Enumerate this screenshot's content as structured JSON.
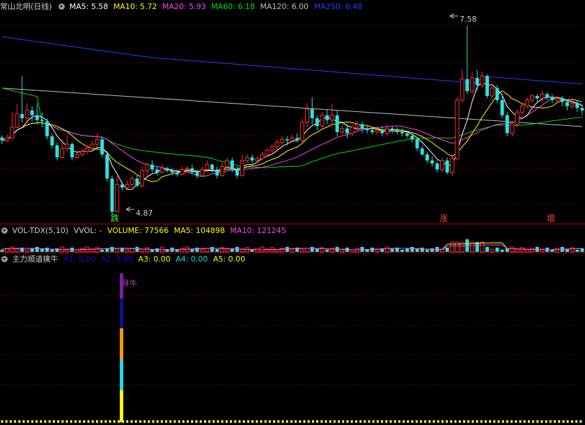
{
  "main_panel": {
    "stock_name": "常山北明",
    "period": "(日线)",
    "ma": [
      {
        "label": "MA5: ",
        "value": "5.58",
        "color": "#ffffff"
      },
      {
        "label": "MA10: ",
        "value": "5.72",
        "color": "#ffff00"
      },
      {
        "label": "MA20: ",
        "value": "5.93",
        "color": "#ff40ff"
      },
      {
        "label": "MA60: ",
        "value": "6.18",
        "color": "#00e000"
      },
      {
        "label": "MA120: ",
        "value": "6.00",
        "color": "#c0c0c0"
      },
      {
        "label": "MA250: ",
        "value": "6.48",
        "color": "#2040ff"
      }
    ],
    "high_marker": "7.58",
    "low_marker": "4.87",
    "signals": [
      {
        "text": "跌",
        "color": "#40ff40"
      },
      {
        "text": "涨",
        "color": "#ff4040"
      },
      {
        "text": "增",
        "color": "#ff4040"
      }
    ]
  },
  "volume_panel": {
    "indicator": "VOL-TDX(5,10)",
    "vvol": "VVOL: -",
    "volume_label": "VOLUME: ",
    "volume_value": "77566",
    "ma5_label": "MA5: ",
    "ma5_value": "104898",
    "ma10_label": "MA10: ",
    "ma10_value": "121245"
  },
  "indicator_panel": {
    "name": "主力顺道擒牛",
    "items": [
      {
        "label": "A1: ",
        "value": "0.00",
        "color": "#1010c0"
      },
      {
        "label": "A2: ",
        "value": "0.00",
        "color": "#1010c0"
      },
      {
        "label": "A3: ",
        "value": "0.00",
        "color": "#ffff00"
      },
      {
        "label": "A4: ",
        "value": "0.00",
        "color": "#00e0e0"
      },
      {
        "label": "A5: ",
        "value": "0.00",
        "color": "#ffff00"
      }
    ],
    "signal_label": "寻牛"
  },
  "colors": {
    "up": "#ff3030",
    "down": "#30e0e0",
    "grid": "#6a0000",
    "panel_border": "#c00000"
  },
  "ohlc": [
    [
      5.73,
      5.68,
      5.62,
      5.76
    ],
    [
      5.68,
      5.72,
      5.65,
      5.78
    ],
    [
      5.72,
      5.9,
      5.7,
      6.15
    ],
    [
      5.9,
      6.12,
      5.88,
      6.28
    ],
    [
      6.12,
      6.05,
      5.98,
      6.75
    ],
    [
      6.05,
      6.18,
      6.0,
      6.3
    ],
    [
      6.18,
      6.1,
      6.0,
      6.25
    ],
    [
      6.1,
      6.02,
      5.95,
      6.3
    ],
    [
      6.02,
      6.0,
      5.9,
      6.15
    ],
    [
      6.0,
      5.75,
      5.7,
      6.05
    ],
    [
      5.75,
      5.6,
      5.55,
      5.8
    ],
    [
      5.6,
      5.4,
      5.35,
      5.65
    ],
    [
      5.4,
      5.55,
      5.38,
      5.7
    ],
    [
      5.55,
      5.62,
      5.5,
      5.75
    ],
    [
      5.62,
      5.4,
      5.35,
      5.65
    ],
    [
      5.4,
      5.45,
      5.38,
      5.52
    ],
    [
      5.45,
      5.5,
      5.42,
      5.55
    ],
    [
      5.5,
      5.55,
      5.45,
      5.6
    ],
    [
      5.55,
      5.62,
      5.5,
      5.68
    ],
    [
      5.62,
      5.7,
      5.58,
      5.8
    ],
    [
      5.7,
      5.45,
      5.4,
      5.75
    ],
    [
      5.45,
      5.05,
      5.0,
      5.5
    ],
    [
      5.05,
      4.5,
      4.45,
      5.1
    ],
    [
      4.5,
      4.95,
      4.87,
      5.1
    ],
    [
      4.95,
      4.9,
      4.85,
      5.0
    ],
    [
      4.9,
      4.95,
      4.88,
      5.02
    ],
    [
      4.95,
      5.05,
      4.9,
      5.1
    ],
    [
      5.05,
      4.93,
      4.9,
      5.1
    ],
    [
      4.93,
      5.18,
      4.9,
      5.25
    ],
    [
      5.18,
      5.28,
      5.1,
      5.32
    ],
    [
      5.28,
      5.2,
      5.15,
      5.35
    ],
    [
      5.2,
      5.15,
      5.1,
      5.25
    ],
    [
      5.15,
      5.22,
      5.12,
      5.28
    ],
    [
      5.22,
      5.18,
      5.15,
      5.25
    ],
    [
      5.18,
      5.15,
      5.1,
      5.22
    ],
    [
      5.15,
      5.12,
      5.08,
      5.2
    ],
    [
      5.12,
      5.2,
      5.1,
      5.25
    ],
    [
      5.2,
      5.22,
      5.15,
      5.25
    ],
    [
      5.22,
      5.15,
      5.12,
      5.28
    ],
    [
      5.15,
      5.1,
      5.05,
      5.2
    ],
    [
      5.1,
      5.2,
      5.08,
      5.25
    ],
    [
      5.2,
      5.28,
      5.15,
      5.35
    ],
    [
      5.28,
      5.2,
      5.15,
      5.3
    ],
    [
      5.2,
      5.1,
      5.05,
      5.25
    ],
    [
      5.1,
      5.25,
      5.08,
      5.32
    ],
    [
      5.25,
      5.35,
      5.2,
      5.4
    ],
    [
      5.35,
      5.2,
      5.15,
      5.4
    ],
    [
      5.2,
      5.1,
      5.05,
      5.25
    ],
    [
      5.1,
      5.35,
      5.08,
      5.45
    ],
    [
      5.35,
      5.4,
      5.3,
      5.45
    ],
    [
      5.4,
      5.35,
      5.3,
      5.45
    ],
    [
      5.35,
      5.38,
      5.3,
      5.42
    ],
    [
      5.38,
      5.45,
      5.35,
      5.5
    ],
    [
      5.45,
      5.52,
      5.4,
      5.55
    ],
    [
      5.52,
      5.58,
      5.45,
      5.62
    ],
    [
      5.58,
      5.65,
      5.5,
      5.7
    ],
    [
      5.65,
      5.7,
      5.6,
      5.75
    ],
    [
      5.7,
      5.68,
      5.6,
      5.75
    ],
    [
      5.68,
      5.72,
      5.65,
      5.78
    ],
    [
      5.72,
      5.68,
      5.65,
      5.8
    ],
    [
      5.68,
      5.98,
      5.62,
      6.05
    ],
    [
      5.98,
      6.2,
      5.9,
      6.3
    ],
    [
      6.2,
      6.05,
      5.95,
      6.4
    ],
    [
      6.05,
      5.92,
      5.85,
      6.1
    ],
    [
      5.92,
      6.1,
      5.88,
      6.15
    ],
    [
      6.1,
      6.02,
      5.95,
      6.2
    ],
    [
      6.02,
      6.1,
      5.95,
      6.28
    ],
    [
      6.1,
      5.82,
      5.75,
      6.18
    ],
    [
      5.82,
      5.88,
      5.78,
      5.95
    ],
    [
      5.88,
      5.8,
      5.72,
      5.95
    ],
    [
      5.8,
      5.9,
      5.75,
      5.95
    ],
    [
      5.9,
      5.95,
      5.85,
      6.0
    ],
    [
      5.95,
      5.88,
      5.8,
      6.0
    ],
    [
      5.88,
      5.85,
      5.8,
      5.92
    ],
    [
      5.85,
      5.82,
      5.78,
      5.9
    ],
    [
      5.82,
      5.85,
      5.78,
      5.92
    ],
    [
      5.85,
      5.8,
      5.75,
      5.92
    ],
    [
      5.8,
      5.88,
      5.75,
      5.95
    ],
    [
      5.88,
      5.85,
      5.8,
      5.92
    ],
    [
      5.85,
      5.82,
      5.78,
      5.9
    ],
    [
      5.82,
      5.8,
      5.75,
      5.88
    ],
    [
      5.8,
      5.76,
      5.72,
      5.85
    ],
    [
      5.76,
      5.7,
      5.65,
      5.8
    ],
    [
      5.7,
      5.55,
      5.5,
      5.72
    ],
    [
      5.55,
      5.45,
      5.42,
      5.6
    ],
    [
      5.45,
      5.35,
      5.3,
      5.5
    ],
    [
      5.35,
      5.3,
      5.25,
      5.42
    ],
    [
      5.3,
      5.2,
      5.15,
      5.35
    ],
    [
      5.2,
      5.35,
      5.15,
      5.4
    ],
    [
      5.35,
      5.15,
      5.12,
      5.4
    ],
    [
      5.15,
      5.38,
      5.1,
      5.42
    ],
    [
      5.38,
      6.35,
      5.35,
      6.4
    ],
    [
      6.35,
      6.7,
      6.3,
      6.85
    ],
    [
      6.7,
      6.5,
      6.45,
      7.58
    ],
    [
      6.5,
      6.72,
      6.45,
      6.82
    ],
    [
      6.72,
      6.6,
      6.5,
      6.85
    ],
    [
      6.6,
      6.75,
      6.55,
      6.82
    ],
    [
      6.75,
      6.42,
      6.38,
      6.78
    ],
    [
      6.42,
      6.55,
      6.35,
      6.62
    ],
    [
      6.55,
      6.35,
      6.3,
      6.6
    ],
    [
      6.35,
      6.1,
      6.05,
      6.45
    ],
    [
      6.1,
      5.8,
      5.75,
      6.15
    ],
    [
      5.8,
      5.95,
      5.75,
      6.0
    ],
    [
      5.95,
      6.15,
      5.9,
      6.2
    ],
    [
      6.15,
      6.25,
      6.1,
      6.3
    ],
    [
      6.25,
      6.35,
      6.2,
      6.4
    ],
    [
      6.35,
      6.42,
      6.3,
      6.45
    ],
    [
      6.42,
      6.38,
      6.3,
      6.45
    ],
    [
      6.38,
      6.45,
      6.32,
      6.5
    ],
    [
      6.45,
      6.4,
      6.35,
      6.48
    ],
    [
      6.4,
      6.35,
      6.3,
      6.45
    ],
    [
      6.35,
      6.38,
      6.3,
      6.42
    ],
    [
      6.38,
      6.32,
      6.25,
      6.42
    ],
    [
      6.32,
      6.25,
      6.18,
      6.36
    ],
    [
      6.25,
      6.3,
      6.2,
      6.35
    ],
    [
      6.3,
      6.22,
      6.15,
      6.35
    ],
    [
      6.22,
      6.18,
      6.1,
      6.28
    ]
  ]
}
